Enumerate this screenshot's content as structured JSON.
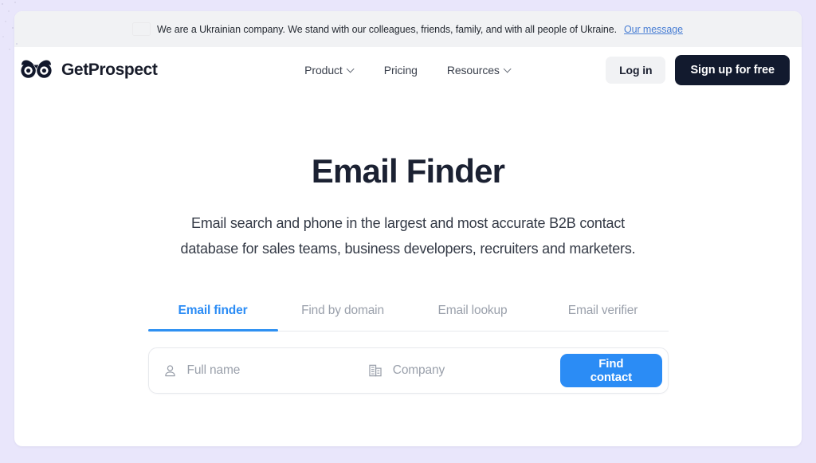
{
  "banner": {
    "flag_icon": "ukraine-flag-icon",
    "text": "We are a Ukrainian company. We stand with our colleagues, friends, family, and with all people of Ukraine.",
    "link_label": "Our message",
    "background": "#f1f2f4",
    "link_color": "#4a7fd4"
  },
  "header": {
    "logo_icon": "owl-logo-icon",
    "brand": "GetProspect",
    "nav": [
      {
        "label": "Product",
        "has_dropdown": true
      },
      {
        "label": "Pricing",
        "has_dropdown": false
      },
      {
        "label": "Resources",
        "has_dropdown": true
      }
    ],
    "login_label": "Log in",
    "signup_label": "Sign up for free",
    "signup_color": "#121a2e"
  },
  "hero": {
    "title": "Email Finder",
    "subtitle": "Email search and phone in the largest and most accurate B2B contact database for sales teams, business developers, recruiters and marketers."
  },
  "tabs": {
    "active_index": 0,
    "active_color": "#2b8cf5",
    "items": [
      {
        "label": "Email finder"
      },
      {
        "label": "Find by domain"
      },
      {
        "label": "Email lookup"
      },
      {
        "label": "Email verifier"
      }
    ]
  },
  "search": {
    "name_icon": "person-icon",
    "name_value": "",
    "name_placeholder": "Full name",
    "company_icon": "building-icon",
    "company_value": "",
    "company_placeholder": "Company",
    "submit_label": "Find contact",
    "submit_color": "#2b8cf5"
  }
}
